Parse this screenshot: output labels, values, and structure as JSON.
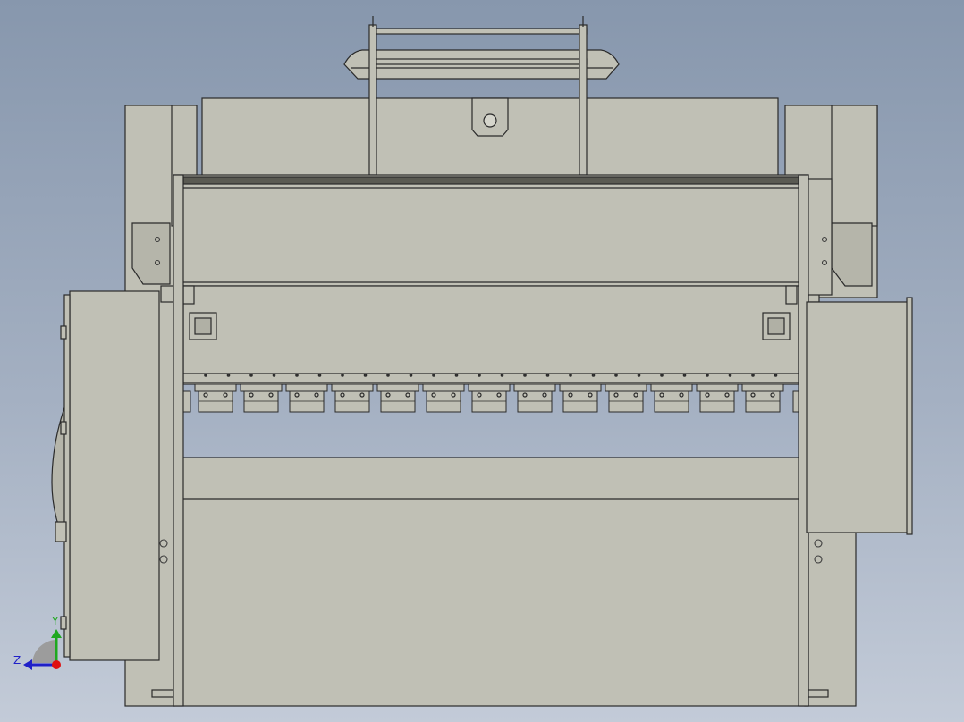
{
  "viewport": {
    "background_top": "#8797ad",
    "background_bottom": "#c3cbd8"
  },
  "model": {
    "body_fill": "#c0c0b5",
    "edge_color": "#2a2a2a",
    "hole_color": "#3a3a3a"
  },
  "triad": {
    "y_label": "Y",
    "z_label": "Z",
    "y_color": "#1fa81f",
    "z_color": "#1f1fc8",
    "origin_color": "#e01010"
  }
}
